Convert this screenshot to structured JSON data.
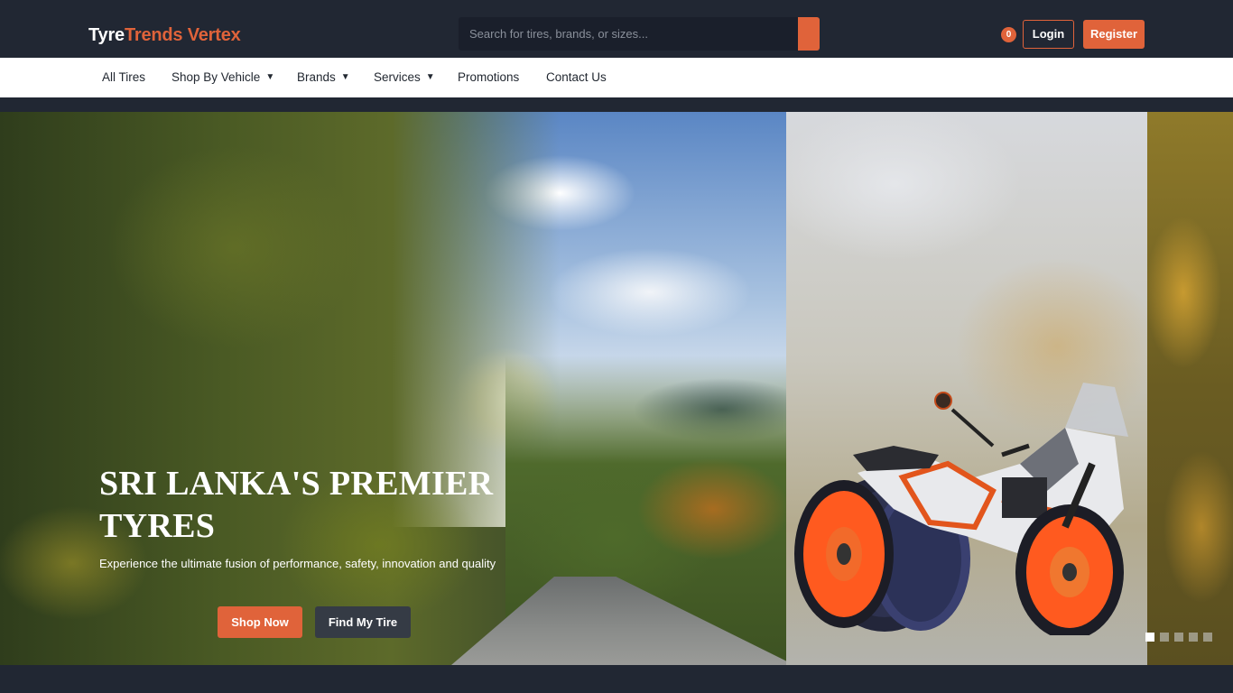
{
  "brand": {
    "part1": "Tyre",
    "part2": "Trends Vertex"
  },
  "search": {
    "placeholder": "Search for tires, brands, or sizes...",
    "button_icon": "search-icon"
  },
  "header": {
    "cart_count": "0",
    "login_label": "Login",
    "register_label": "Register"
  },
  "nav": {
    "items": [
      {
        "label": "All Tires",
        "dropdown": false
      },
      {
        "label": "Shop By Vehicle",
        "dropdown": true
      },
      {
        "label": "Brands",
        "dropdown": true
      },
      {
        "label": "Services",
        "dropdown": true
      },
      {
        "label": "Promotions",
        "dropdown": false
      },
      {
        "label": "Contact Us",
        "dropdown": false
      }
    ]
  },
  "hero": {
    "title_line1": "SRI LANKA'S PREMIER",
    "title_line2": "TYRES",
    "subtitle": "Experience the ultimate fusion of performance, safety, innovation and quality",
    "shop_label": "Shop Now",
    "find_label": "Find My Tire",
    "slide_count": 5,
    "active_slide": 1
  },
  "colors": {
    "accent": "#e0633a",
    "header_bg": "#212733",
    "nav_bg": "#ffffff",
    "dark_button": "#353b45"
  }
}
